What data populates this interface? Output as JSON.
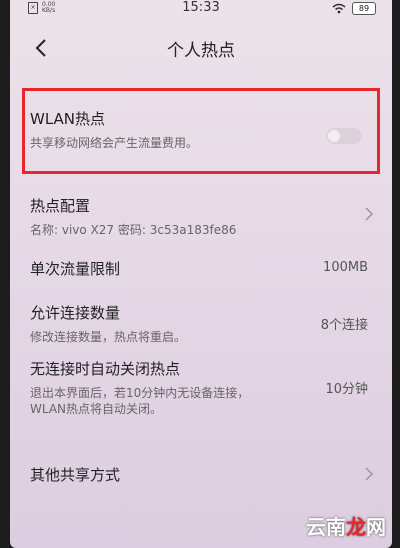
{
  "status_bar": {
    "net_speed_top": "0.00",
    "net_speed_bottom": "KB/s",
    "time": "15:33",
    "battery": "89"
  },
  "header": {
    "title": "个人热点"
  },
  "wlan_hotspot": {
    "title": "WLAN热点",
    "subtitle": "共享移动网络会产生流量费用。",
    "enabled": false
  },
  "hotspot_config": {
    "title": "热点配置",
    "subtitle": "名称: vivo X27  密码: 3c53a183fe86"
  },
  "data_limit": {
    "title": "单次流量限制",
    "value": "100MB"
  },
  "max_connections": {
    "title": "允许连接数量",
    "subtitle": "修改连接数量，热点将重启。",
    "value": "8个连接"
  },
  "auto_off": {
    "title": "无连接时自动关闭热点",
    "subtitle_line1": "退出本界面后，若10分钟内无设备连接，",
    "subtitle_line2": "WLAN热点将自动关闭。",
    "value": "10分钟"
  },
  "other_share": {
    "title": "其他共享方式"
  },
  "watermark": {
    "part1": "云南",
    "part2": "龙",
    "part3": "网"
  },
  "colors": {
    "highlight": "#e8262e"
  }
}
